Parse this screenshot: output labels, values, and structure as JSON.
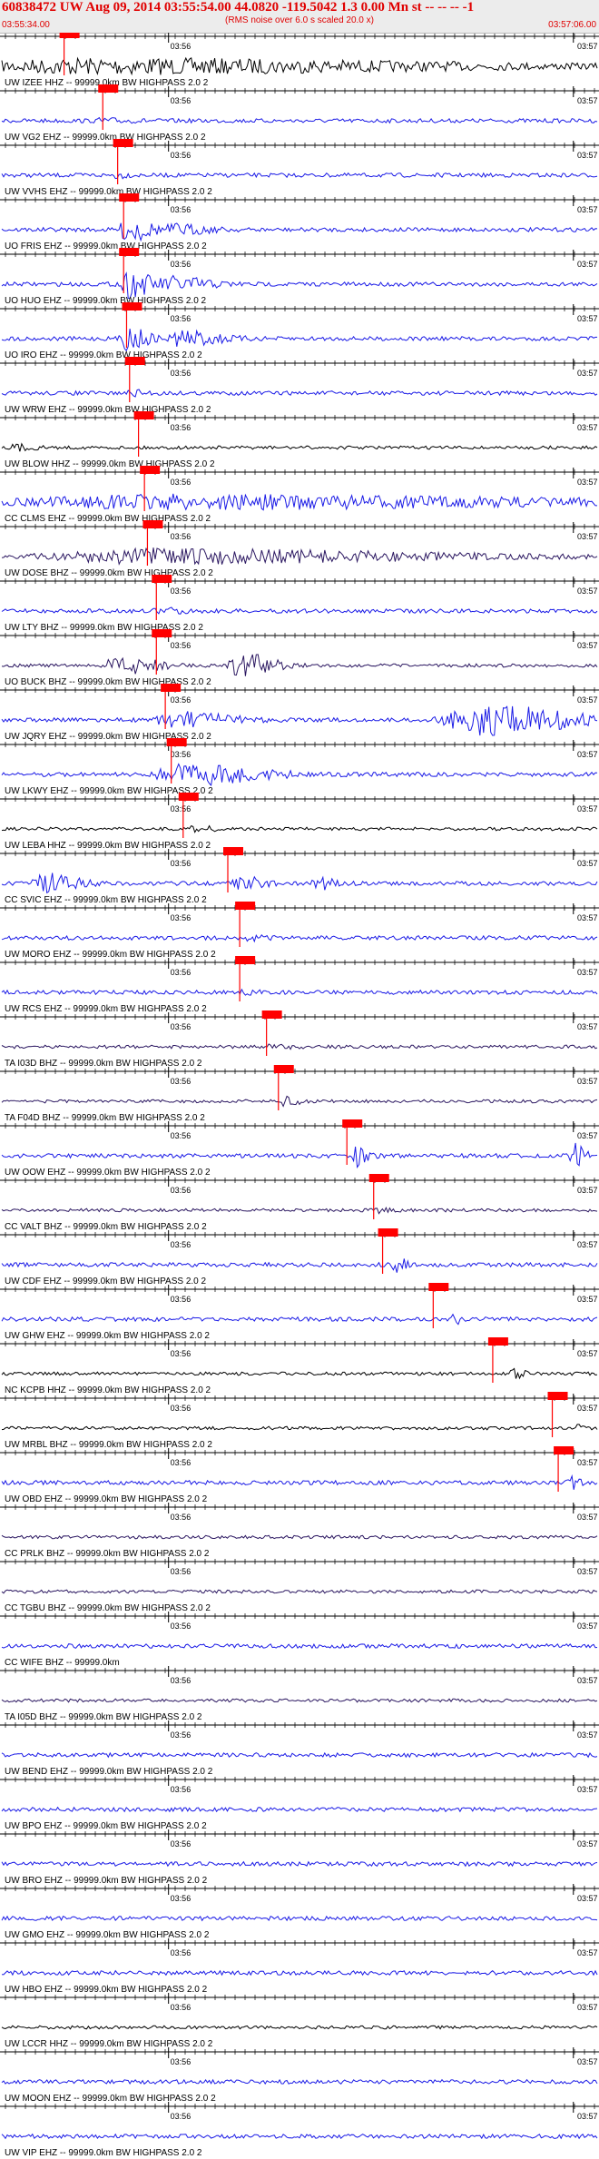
{
  "header": {
    "title": "60838472 UW Aug 09, 2014 03:55:54.00   44.0820 -119.5042  1.3 0.00 Mn st -- -- --  -1",
    "subtitle": "(RMS noise over 6.0 s scaled 20.0 x)",
    "time_start": "03:55:34.00",
    "time_end": "03:57:06.00"
  },
  "colors": {
    "blue": "#1a1ae6",
    "dark": "#2a1660",
    "black": "#000000",
    "pick": "#ff0000",
    "text": "#000000"
  },
  "chart_data": {
    "type": "line",
    "x_unit": "time (UTC)",
    "x_range": [
      "03:55:34.00",
      "03:57:06.00"
    ],
    "tick_labels": [
      "03:56",
      "03:57"
    ],
    "traces": [
      {
        "label": "UW IZEE HHZ -- 99999.0km BW  HIGHPASS  2.0  2",
        "color": "black",
        "pick_frac": 0.1,
        "events": [
          [
            0.12,
            0.7,
            8,
            1.0
          ]
        ]
      },
      {
        "label": "UW VG2 EHZ -- 99999.0km BW  HIGHPASS  2.0  2",
        "color": "blue",
        "pick_frac": 0.165,
        "events": [
          [
            0.165,
            0.03,
            1.5,
            0.5
          ]
        ]
      },
      {
        "label": "UW VVHS EHZ -- 99999.0km BW  HIGHPASS  2.0  2",
        "color": "blue",
        "pick_frac": 0.19,
        "events": [
          [
            0.19,
            0.03,
            2.5,
            1.5
          ]
        ]
      },
      {
        "label": "UO FRIS EHZ -- 99999.0km BW  HIGHPASS  2.0  2",
        "color": "blue",
        "pick_frac": 0.2,
        "events": [
          [
            0.21,
            0.04,
            14,
            0.9
          ],
          [
            0.29,
            0.06,
            5,
            1
          ]
        ]
      },
      {
        "label": "UO HUO EHZ -- 99999.0km BW  HIGHPASS  2.0  2",
        "color": "blue",
        "pick_frac": 0.2,
        "events": [
          [
            0.21,
            0.05,
            14,
            1
          ],
          [
            0.29,
            0.07,
            7,
            1
          ]
        ]
      },
      {
        "label": "UO IRO EHZ -- 99999.0km BW  HIGHPASS  2.0  2",
        "color": "blue",
        "pick_frac": 0.205,
        "events": [
          [
            0.21,
            0.04,
            12,
            1
          ],
          [
            0.3,
            0.07,
            9,
            1
          ]
        ]
      },
      {
        "label": "UW WRW EHZ -- 99999.0km BW  HIGHPASS  2.0  2",
        "color": "blue",
        "pick_frac": 0.21,
        "events": [
          [
            0.22,
            0.03,
            2,
            0.8
          ]
        ]
      },
      {
        "label": "UW BLOW HHZ -- 99999.0km BW  HIGHPASS  2.0  2",
        "color": "black",
        "pick_frac": 0.225,
        "events": [
          [
            0.02,
            0.02,
            3,
            0.5
          ]
        ]
      },
      {
        "label": "CC CLMS EHZ -- 99999.0km BW  HIGHPASS  2.0  2",
        "color": "blue",
        "pick_frac": 0.235,
        "events": [
          [
            0.24,
            0.75,
            7,
            1.0
          ]
        ]
      },
      {
        "label": "UW DOSE BHZ -- 99999.0km BW  HIGHPASS  2.0  2",
        "color": "dark",
        "pick_frac": 0.24,
        "events": [
          [
            0.24,
            0.6,
            8,
            1.2
          ]
        ]
      },
      {
        "label": "UW LTY BHZ -- 99999.0km BW  HIGHPASS  2.0  2",
        "color": "blue",
        "pick_frac": 0.255,
        "events": [
          [
            0.26,
            0.02,
            3,
            0.5
          ]
        ]
      },
      {
        "label": "UO BUCK BHZ -- 99999.0km BW  HIGHPASS  2.0  2",
        "color": "dark",
        "pick_frac": 0.255,
        "events": [
          [
            0.2,
            0.1,
            10,
            1.5
          ],
          [
            0.4,
            0.06,
            14,
            1.0
          ]
        ]
      },
      {
        "label": "UW JQRY EHZ -- 99999.0km BW  HIGHPASS  2.0  2",
        "color": "blue",
        "pick_frac": 0.27,
        "events": [
          [
            0.29,
            0.1,
            8,
            1.0
          ],
          [
            0.8,
            0.2,
            16,
            1.2
          ]
        ]
      },
      {
        "label": "UW LKWY EHZ -- 99999.0km BW  HIGHPASS  2.0  2",
        "color": "blue",
        "pick_frac": 0.28,
        "events": [
          [
            0.3,
            0.14,
            11,
            1.0
          ]
        ]
      },
      {
        "label": "UW LEBA HHZ -- 99999.0km BW  HIGHPASS  2.0  2",
        "color": "black",
        "pick_frac": 0.3,
        "events": [
          [
            0.32,
            0.03,
            3,
            0.7
          ]
        ]
      },
      {
        "label": "CC SVIC EHZ -- 99999.0km BW  HIGHPASS  2.0  2",
        "color": "blue",
        "pick_frac": 0.375,
        "events": [
          [
            0.07,
            0.06,
            11,
            1.0
          ],
          [
            0.39,
            0.05,
            9,
            1
          ],
          [
            0.53,
            0.03,
            7,
            1
          ]
        ]
      },
      {
        "label": "UW MORO EHZ -- 99999.0km BW  HIGHPASS  2.0  2",
        "color": "blue",
        "pick_frac": 0.395,
        "events": [
          [
            0.41,
            0.03,
            2,
            0.8
          ]
        ]
      },
      {
        "label": "UW RCS EHZ -- 99999.0km BW  HIGHPASS  2.0  2",
        "color": "blue",
        "pick_frac": 0.395,
        "events": [
          [
            0.41,
            0.03,
            3,
            1.2
          ]
        ]
      },
      {
        "label": "TA I03D BHZ -- 99999.0km BW  HIGHPASS  2.0  2",
        "color": "dark",
        "pick_frac": 0.44,
        "events": [
          [
            0.45,
            0.04,
            2,
            0.8
          ]
        ]
      },
      {
        "label": "TA F04D BHZ -- 99999.0km BW  HIGHPASS  2.0  2",
        "color": "dark",
        "pick_frac": 0.46,
        "events": [
          [
            0.47,
            0.03,
            5,
            1.0
          ]
        ]
      },
      {
        "label": "UW OOW EHZ -- 99999.0km BW  HIGHPASS  2.0  2",
        "color": "blue",
        "pick_frac": 0.575,
        "events": [
          [
            0.595,
            0.02,
            13,
            1.0
          ],
          [
            0.96,
            0.02,
            13,
            1.0
          ]
        ]
      },
      {
        "label": "CC VALT BHZ -- 99999.0km BW  HIGHPASS  2.0  2",
        "color": "dark",
        "pick_frac": 0.62,
        "events": [
          [
            0.63,
            0.03,
            2,
            1.0
          ]
        ]
      },
      {
        "label": "UW CDF EHZ -- 99999.0km BW  HIGHPASS  2.0  2",
        "color": "blue",
        "pick_frac": 0.635,
        "events": [
          [
            0.66,
            0.02,
            10,
            1.0
          ]
        ]
      },
      {
        "label": "UW GHW EHZ -- 99999.0km BW  HIGHPASS  2.0  2",
        "color": "blue",
        "pick_frac": 0.72,
        "events": [
          [
            0.76,
            0.02,
            5,
            1.8
          ]
        ]
      },
      {
        "label": "NC KCPB HHZ -- 99999.0km BW  HIGHPASS  2.0  2",
        "color": "black",
        "pick_frac": 0.82,
        "events": [
          [
            0.86,
            0.02,
            6,
            1.2
          ]
        ]
      },
      {
        "label": "UW MRBL BHZ -- 99999.0km BW  HIGHPASS  2.0  2",
        "color": "black",
        "pick_frac": 0.92,
        "events": [
          [
            0.96,
            0.03,
            4,
            1.5
          ]
        ]
      },
      {
        "label": "UW OBD EHZ -- 99999.0km BW  HIGHPASS  2.0  2",
        "color": "blue",
        "pick_frac": 0.93,
        "events": [
          [
            0.955,
            0.02,
            12,
            1.5
          ]
        ]
      },
      {
        "label": "CC PRLK BHZ -- 99999.0km BW  HIGHPASS  2.0  2",
        "color": "dark",
        "pick_frac": null,
        "events": []
      },
      {
        "label": "CC TGBU BHZ -- 99999.0km BW  HIGHPASS  2.0  2",
        "color": "dark",
        "pick_frac": null,
        "events": []
      },
      {
        "label": "CC WIFE BHZ -- 99999.0km",
        "color": "blue",
        "pick_frac": null,
        "events": []
      },
      {
        "label": "TA I05D BHZ -- 99999.0km BW  HIGHPASS  2.0  2",
        "color": "dark",
        "pick_frac": null,
        "events": []
      },
      {
        "label": "UW BEND EHZ -- 99999.0km BW  HIGHPASS  2.0  2",
        "color": "blue",
        "pick_frac": null,
        "events": []
      },
      {
        "label": "UW BPO EHZ -- 99999.0km BW  HIGHPASS  2.0  2",
        "color": "blue",
        "pick_frac": null,
        "events": []
      },
      {
        "label": "UW BRO EHZ -- 99999.0km BW  HIGHPASS  2.0  2",
        "color": "blue",
        "pick_frac": null,
        "events": []
      },
      {
        "label": "UW GMO EHZ -- 99999.0km BW  HIGHPASS  2.0  2",
        "color": "blue",
        "pick_frac": null,
        "events": []
      },
      {
        "label": "UW HBO EHZ -- 99999.0km BW  HIGHPASS  2.0  2",
        "color": "blue",
        "pick_frac": null,
        "events": []
      },
      {
        "label": "UW LCCR HHZ -- 99999.0km BW  HIGHPASS  2.0  2",
        "color": "black",
        "pick_frac": null,
        "events": []
      },
      {
        "label": "UW MOON EHZ -- 99999.0km BW  HIGHPASS  2.0  2",
        "color": "blue",
        "pick_frac": null,
        "events": []
      },
      {
        "label": "UW VIP EHZ -- 99999.0km BW  HIGHPASS  2.0  2",
        "color": "blue",
        "pick_frac": null,
        "events": []
      }
    ]
  }
}
